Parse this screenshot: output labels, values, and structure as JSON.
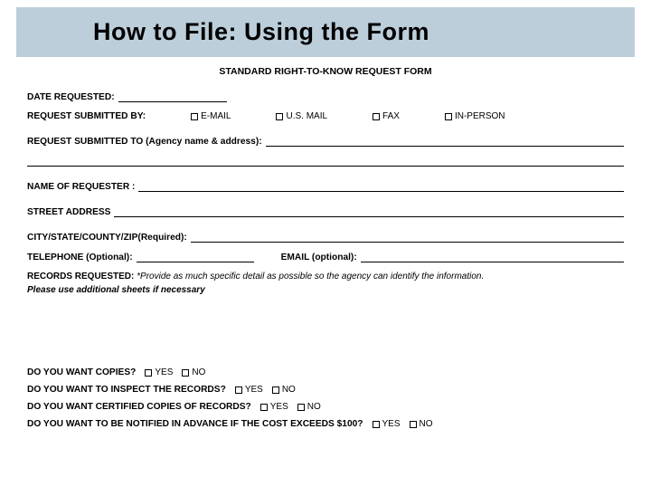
{
  "header": {
    "title": "How to File: Using the Form"
  },
  "form": {
    "title": "STANDARD RIGHT-TO-KNOW REQUEST FORM",
    "date_label": "DATE REQUESTED:",
    "submitted_by_label": "REQUEST SUBMITTED BY:",
    "submit_options": {
      "email": "E-MAIL",
      "usmail": "U.S. MAIL",
      "fax": "FAX",
      "inperson": "IN-PERSON"
    },
    "submitted_to_label": "REQUEST SUBMITTED TO (Agency name & address):",
    "name_label": "NAME OF REQUESTER :",
    "street_label": "STREET ADDRESS",
    "city_label": "CITY/STATE/COUNTY/ZIP(Required):",
    "phone_label": "TELEPHONE (Optional):",
    "email_label": "EMAIL (optional):",
    "records_label": "RECORDS REQUESTED:",
    "records_hint": "*Provide as much specific detail as possible so the agency can identify the information.",
    "records_sheets": "Please use additional sheets if necessary",
    "q_copies": "DO YOU WANT COPIES?",
    "q_inspect": "DO YOU WANT TO INSPECT THE RECORDS?",
    "q_certified": "DO YOU WANT CERTIFIED COPIES OF RECORDS?",
    "q_cost": "DO YOU WANT TO BE NOTIFIED IN ADVANCE IF THE COST EXCEEDS $100?",
    "yes": "YES",
    "no": "NO"
  }
}
